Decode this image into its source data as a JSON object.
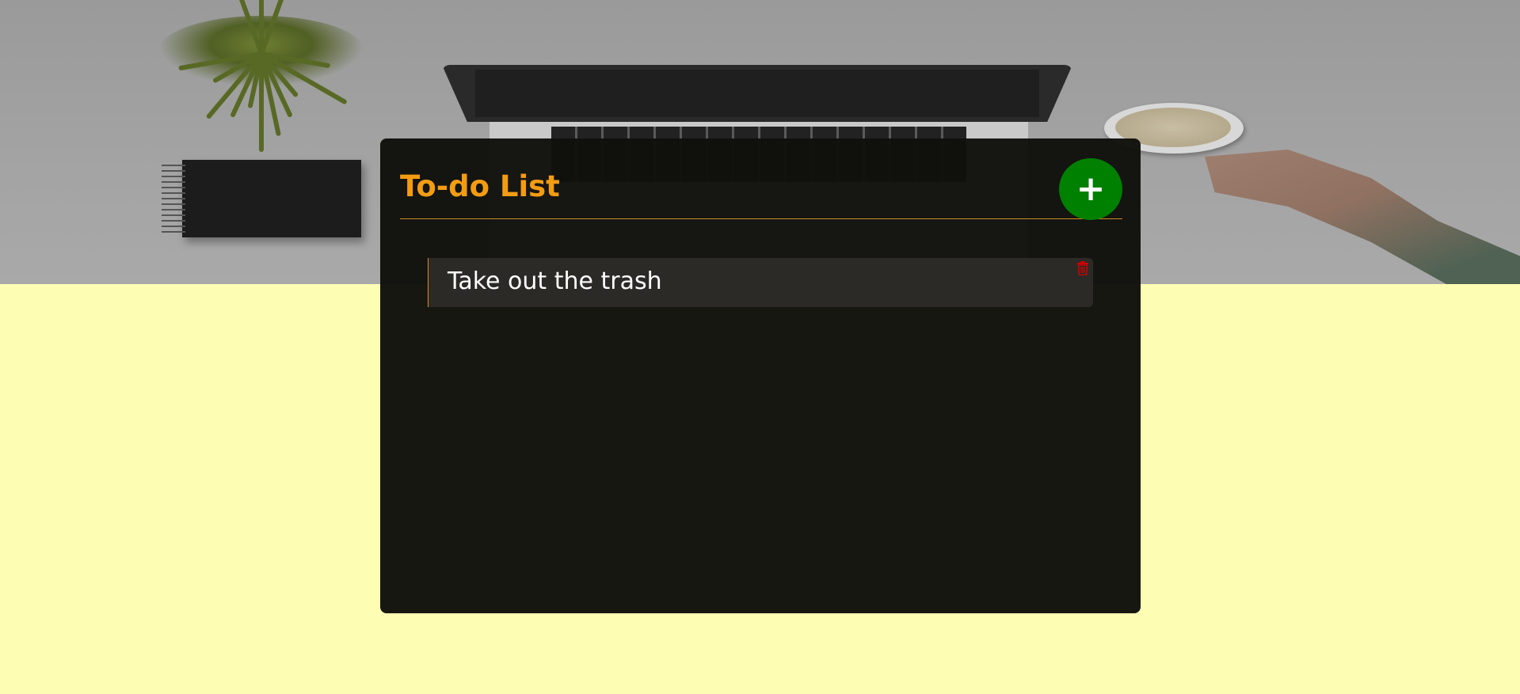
{
  "header": {
    "title": "To-do List",
    "add_label": "+"
  },
  "todos": [
    {
      "text": "Take out the trash"
    }
  ],
  "icons": {
    "add": "plus-icon",
    "delete": "trash-icon"
  },
  "colors": {
    "page_background": "#fdfdb4",
    "panel_background": "#10100c",
    "title": "#f39c12",
    "add_button": "#008000",
    "item_background": "#2b2a26",
    "item_accent": "#e08a1e",
    "delete_icon": "#d10000"
  }
}
